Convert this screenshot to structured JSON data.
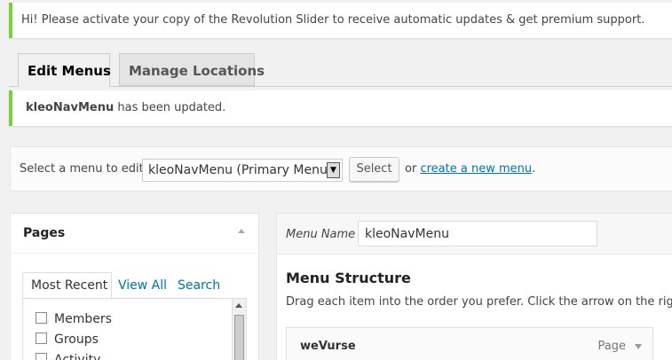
{
  "notices": {
    "revslider": "Hi! Please activate your copy of the Revolution Slider to receive automatic updates & get premium support.",
    "updated_name": "kleoNavMenu",
    "updated_suffix": " has been updated."
  },
  "tabs": {
    "edit": "Edit Menus",
    "manage": "Manage Locations"
  },
  "select_bar": {
    "label": "Select a menu to edit:",
    "selected": "kleoNavMenu (Primary Menu)",
    "button": "Select",
    "or": "or",
    "create_link": "create a new menu",
    "period": "."
  },
  "pages_box": {
    "title": "Pages",
    "tabs": [
      "Most Recent",
      "View All",
      "Search"
    ],
    "items": [
      "Members",
      "Groups",
      "Activity"
    ]
  },
  "menu_box": {
    "name_label": "Menu Name",
    "name_value": "kleoNavMenu",
    "structure_title": "Menu Structure",
    "structure_desc": "Drag each item into the order you prefer. Click the arrow on the right of",
    "items": [
      {
        "title": "weVurse",
        "type": "Page"
      }
    ]
  },
  "colors": {
    "notice_accent": "#7ad03a",
    "link": "#0073aa"
  }
}
